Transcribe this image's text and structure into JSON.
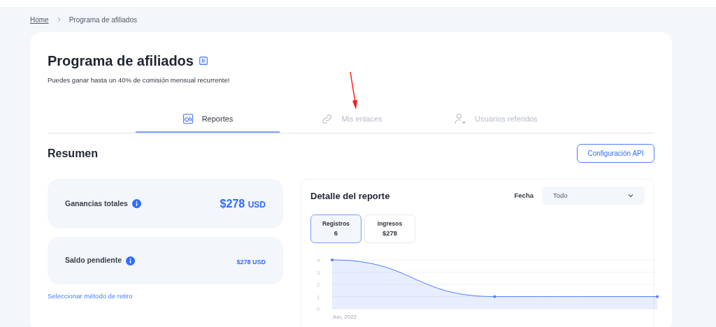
{
  "breadcrumb": [
    {
      "label": "Home",
      "kind": "link"
    },
    {
      "label": "Programa de afiliados",
      "kind": "current"
    }
  ],
  "header": {
    "title": "Programa de afiliados",
    "subtitle": "Puedes ganar hasta un 40% de comisión mensual recurrente!"
  },
  "tabs": [
    {
      "label": "Reportes",
      "selected": true
    },
    {
      "label": "Mis enlaces",
      "selected": false
    },
    {
      "label": "Usuarios referidos",
      "selected": false
    }
  ],
  "summary": {
    "title": "Resumen",
    "api_button": "Configuración API",
    "cards": [
      {
        "label": "Ganancias totales",
        "amount": "$278",
        "currency": "USD",
        "kind": "large"
      },
      {
        "label": "Saldo pendiente",
        "amount": "$278",
        "currency": "USD",
        "kind": "small"
      }
    ],
    "withdraw_link": "Seleccionar método de retiro"
  },
  "report": {
    "title": "Detalle del reporte",
    "date_label": "Fecha",
    "date_value": "Todo",
    "metrics": [
      {
        "label": "Registros",
        "value": "6",
        "selected": true
      },
      {
        "label": "Ingresos",
        "value": "$278",
        "selected": false
      }
    ],
    "chart_data": {
      "type": "area",
      "grid": true,
      "series": [
        {
          "color": "#4a7dff",
          "values": [
            4,
            1,
            1
          ]
        }
      ],
      "ylim": [
        0,
        4
      ],
      "yticks": [
        {
          "value": 0,
          "label": "0"
        },
        {
          "value": 1,
          "label": "1"
        },
        {
          "value": 2,
          "label": "2"
        },
        {
          "value": 3,
          "label": "3"
        },
        {
          "value": 4,
          "label": "4"
        }
      ],
      "annotations": [
        "Jun, 2022"
      ]
    }
  }
}
